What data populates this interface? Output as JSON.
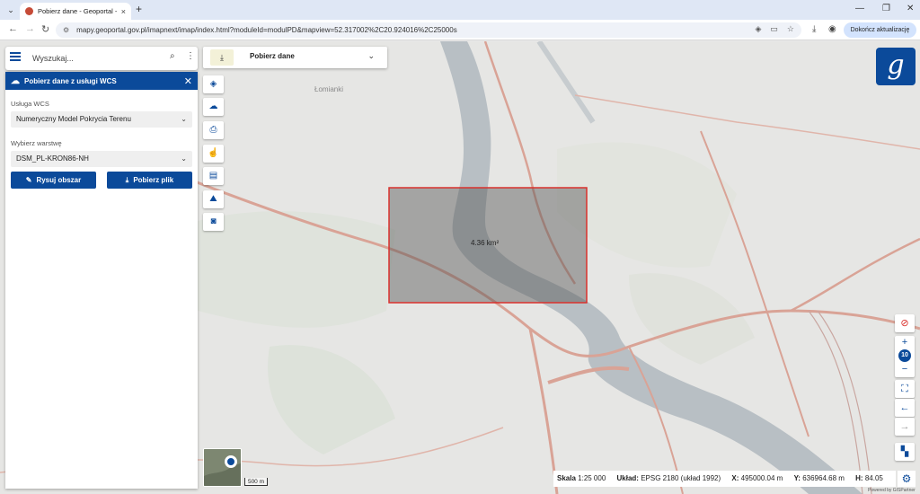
{
  "browser": {
    "tab_title": "Pobierz dane - Geoportal - GU...",
    "tab_close": "×",
    "new_tab": "+",
    "url": "mapy.geoportal.gov.pl/imapnext/imap/index.html?moduleId=modulPD&mapview=52.317002%2C20.924016%2C25000s",
    "update_button": "Dokończ aktualizację"
  },
  "search": {
    "placeholder": "Wyszukaj..."
  },
  "panel": {
    "title": "Pobierz dane z usługi WCS",
    "service_label": "Usługa WCS",
    "service_value": "Numeryczny Model Pokrycia Terenu",
    "layer_label": "Wybierz warstwę",
    "layer_value": "DSM_PL-KRON86-NH",
    "draw_button": "Rysuj obszar",
    "download_button": "Pobierz plik"
  },
  "download_bar": {
    "label": "Pobierz dane"
  },
  "map": {
    "area_label": "4.36 km²",
    "place_label": "Łomianki",
    "zoom_level": "10",
    "scale_label": "500 m",
    "colors": {
      "selection_border": "#d9302c",
      "selection_fill": "#555555",
      "river": "#b8bfc4",
      "roads": "#d9a396"
    }
  },
  "status": {
    "scale_label": "Skala",
    "scale_value": "1:25 000",
    "crs_label": "Układ:",
    "crs_value": "EPSG 2180 (układ 1992)",
    "x_label": "X:",
    "x_value": "495000.04 m",
    "y_label": "Y:",
    "y_value": "636964.68 m",
    "h_label": "H:",
    "h_value": "84.05"
  },
  "credit": "Powered by GISPartner"
}
